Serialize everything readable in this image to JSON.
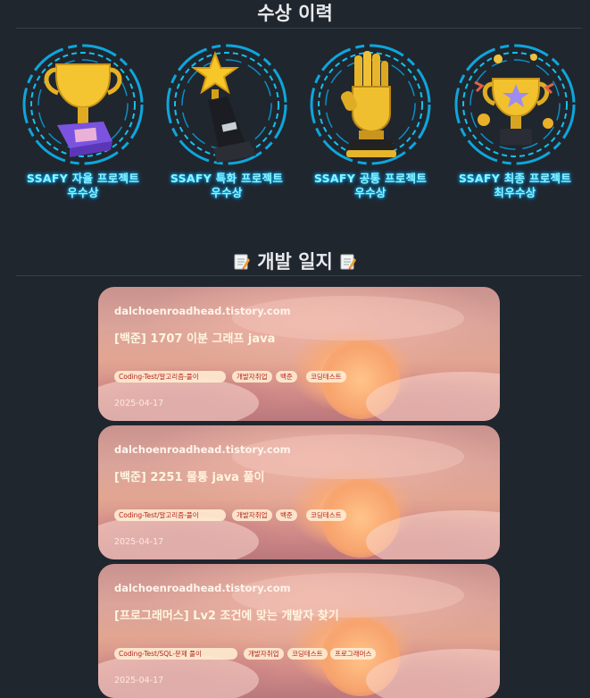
{
  "awards_section": {
    "title": "수상 이력",
    "items": [
      {
        "line1": "SSAFY 자율 프로젝트",
        "line2": "우수상",
        "icon": "trophy-purple-base"
      },
      {
        "line1": "SSAFY 특화 프로젝트",
        "line2": "우수상",
        "icon": "star-trophy"
      },
      {
        "line1": "SSAFY 공통 프로젝트",
        "line2": "우수상",
        "icon": "golden-glove-trophy"
      },
      {
        "line1": "SSAFY 최종 프로젝트",
        "line2": "최우수상",
        "icon": "star-cup-trophy"
      }
    ]
  },
  "devlog_section": {
    "title": "개발 일지",
    "title_icon": "memo-icon",
    "posts": [
      {
        "domain": "dalchoenroadhead.tistory.com",
        "title": "[백준] 1707 이분 그래프 java",
        "tags": [
          "Coding-Test/알고리즘-풀이",
          "개발자취업",
          "백준",
          "코딩테스트"
        ],
        "date": "2025-04-17"
      },
      {
        "domain": "dalchoenroadhead.tistory.com",
        "title": "[백준] 2251 물통 java 풀이",
        "tags": [
          "Coding-Test/알고리즘-풀이",
          "개발자취업",
          "백준",
          "코딩테스트"
        ],
        "date": "2025-04-17"
      },
      {
        "domain": "dalchoenroadhead.tistory.com",
        "title": "[프로그래머스] Lv2 조건에 맞는 개발자 찾기",
        "tags": [
          "Coding-Test/SQL-문제 풀이",
          "개발자취업",
          "코딩테스트",
          "프로그래머스"
        ],
        "date": "2025-04-17"
      }
    ]
  },
  "colors": {
    "background": "#20262e",
    "award_text": "#8ff3ff",
    "ring": "#14b8ea",
    "tag_text": "#b3261e"
  }
}
